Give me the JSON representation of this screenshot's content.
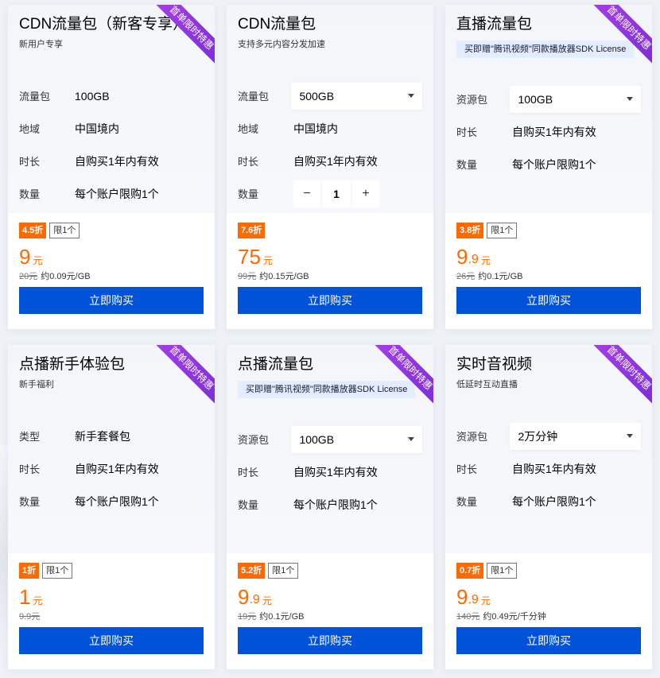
{
  "ribbon_text": "首单限时特惠",
  "buy_label": "立即购买",
  "cards": [
    {
      "title": "CDN流量包（新客专享）",
      "subtitle": "新用户专享",
      "gift": "",
      "ribbon": true,
      "rows": [
        {
          "label": "流量包",
          "value": "100GB",
          "kind": "text"
        },
        {
          "label": "地域",
          "value": "中国境内",
          "kind": "text"
        },
        {
          "label": "时长",
          "value": "自购买1年内有效",
          "kind": "text"
        },
        {
          "label": "数量",
          "value": "每个账户限购1个",
          "kind": "text"
        }
      ],
      "discount": "4.5折",
      "limit": "限1个",
      "price_int": "9",
      "price_dec": "",
      "price_unit": "元",
      "orig_price": "20元",
      "unit_price": "约0.09元/GB"
    },
    {
      "title": "CDN流量包",
      "subtitle": "支持多元内容分发加速",
      "gift": "",
      "ribbon": false,
      "rows": [
        {
          "label": "流量包",
          "value": "500GB",
          "kind": "select"
        },
        {
          "label": "地域",
          "value": "中国境内",
          "kind": "text"
        },
        {
          "label": "时长",
          "value": "自购买1年内有效",
          "kind": "text"
        },
        {
          "label": "数量",
          "value": "1",
          "kind": "stepper",
          "minus": "−",
          "plus": "+"
        }
      ],
      "discount": "7.6折",
      "limit": "",
      "price_int": "75",
      "price_dec": "",
      "price_unit": "元",
      "orig_price": "99元",
      "unit_price": "约0.15元/GB"
    },
    {
      "title": "直播流量包",
      "subtitle": "",
      "gift": "买即赠\"腾讯视频\"同款播放器SDK License",
      "ribbon": true,
      "rows": [
        {
          "label": "资源包",
          "value": "100GB",
          "kind": "select"
        },
        {
          "label": "时长",
          "value": "自购买1年内有效",
          "kind": "text"
        },
        {
          "label": "数量",
          "value": "每个账户限购1个",
          "kind": "text"
        }
      ],
      "discount": "3.8折",
      "limit": "限1个",
      "price_int": "9",
      "price_dec": ".9",
      "price_unit": "元",
      "orig_price": "26元",
      "unit_price": "约0.1元/GB"
    },
    {
      "title": "点播新手体验包",
      "subtitle": "新手福利",
      "gift": "",
      "ribbon": true,
      "rows": [
        {
          "label": "类型",
          "value": "新手套餐包",
          "kind": "text"
        },
        {
          "label": "时长",
          "value": "自购买1年内有效",
          "kind": "text"
        },
        {
          "label": "数量",
          "value": "每个账户限购1个",
          "kind": "text"
        }
      ],
      "discount": "1折",
      "limit": "限1个",
      "price_int": "1",
      "price_dec": "",
      "price_unit": "元",
      "orig_price": "9.9元",
      "unit_price": ""
    },
    {
      "title": "点播流量包",
      "subtitle": "",
      "gift": "买即赠\"腾讯视频\"同款播放器SDK License",
      "ribbon": true,
      "rows": [
        {
          "label": "资源包",
          "value": "100GB",
          "kind": "select"
        },
        {
          "label": "时长",
          "value": "自购买1年内有效",
          "kind": "text"
        },
        {
          "label": "数量",
          "value": "每个账户限购1个",
          "kind": "text"
        }
      ],
      "discount": "5.2折",
      "limit": "限1个",
      "price_int": "9",
      "price_dec": ".9",
      "price_unit": "元",
      "orig_price": "19元",
      "unit_price": "约0.1元/GB"
    },
    {
      "title": "实时音视频",
      "subtitle": "低延时互动直播",
      "gift": "",
      "ribbon": true,
      "rows": [
        {
          "label": "资源包",
          "value": "2万分钟",
          "kind": "select"
        },
        {
          "label": "时长",
          "value": "自购买1年内有效",
          "kind": "text"
        },
        {
          "label": "数量",
          "value": "每个账户限购1个",
          "kind": "text"
        }
      ],
      "discount": "0.7折",
      "limit": "限1个",
      "price_int": "9",
      "price_dec": ".9",
      "price_unit": "元",
      "orig_price": "140元",
      "unit_price": "约0.49元/千分钟"
    }
  ]
}
